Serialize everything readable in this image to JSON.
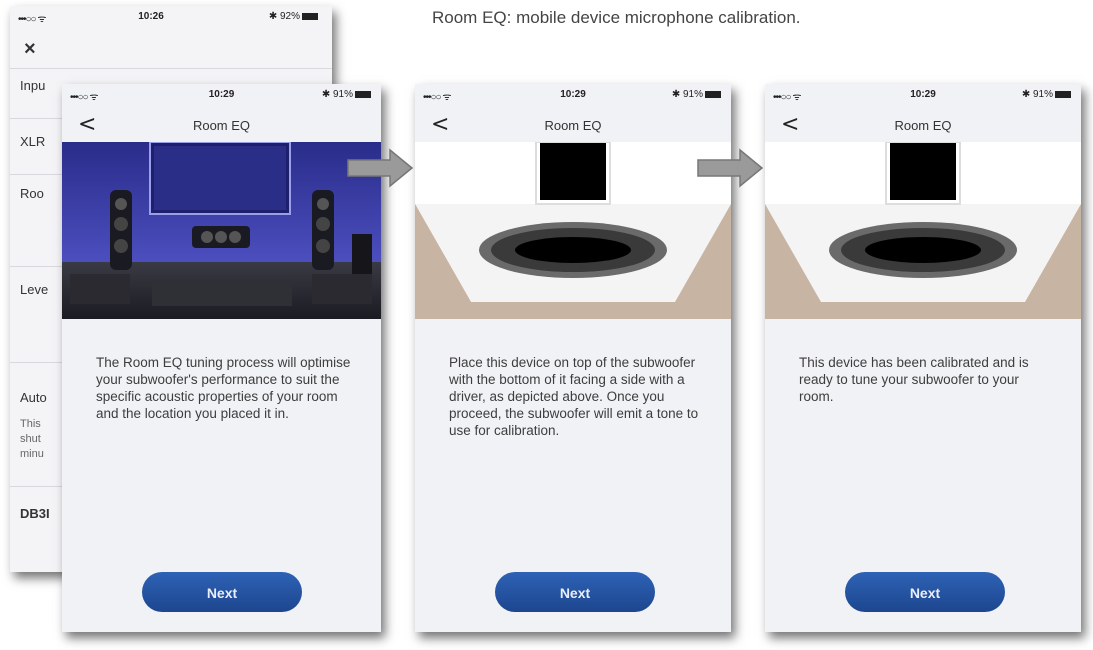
{
  "caption": "Room EQ: mobile device microphone calibration.",
  "settings_phone": {
    "status": {
      "signal": "•••○○ ᯤ",
      "time": "10:26",
      "battery": "✱ 92%"
    },
    "close_glyph": "×",
    "rows": [
      {
        "label": "Inpu",
        "sub": ""
      },
      {
        "label": "XLR",
        "sub": ""
      },
      {
        "label": "Roo",
        "sub": ""
      },
      {
        "label": "Leve",
        "sub": ""
      },
      {
        "label": "Auto",
        "sub": "This shut minu"
      },
      {
        "label": "DB3I",
        "sub": ""
      }
    ]
  },
  "screens": [
    {
      "status": {
        "signal": "•••○○ ᯤ",
        "time": "10:29",
        "battery": "✱ 91%"
      },
      "title": "Room EQ",
      "back_glyph": "<",
      "description": "The Room EQ tuning process will optimise your subwoofer's performance to suit the specific acoustic properties of your room and the location you placed it in.",
      "button": "Next",
      "hero": "home-theater-photo"
    },
    {
      "status": {
        "signal": "•••○○ ᯤ",
        "time": "10:29",
        "battery": "✱ 91%"
      },
      "title": "Room EQ",
      "back_glyph": "<",
      "description": "Place this device on top of the subwoofer with the bottom of it facing a side with a driver, as depicted above. Once you proceed, the subwoofer will emit a tone to use for calibration.",
      "button": "Next",
      "hero": "phone-on-subwoofer-illustration"
    },
    {
      "status": {
        "signal": "•••○○ ᯤ",
        "time": "10:29",
        "battery": "✱ 91%"
      },
      "title": "Room EQ",
      "back_glyph": "<",
      "description": "This device has been calibrated and is ready to tune your subwoofer to your room.",
      "button": "Next",
      "hero": "phone-on-subwoofer-illustration"
    }
  ],
  "colors": {
    "button": "#2557a8",
    "screen_bg": "#f1f2f6",
    "room_wall": "#5d5fd0",
    "floor": "#c9b6a6"
  }
}
